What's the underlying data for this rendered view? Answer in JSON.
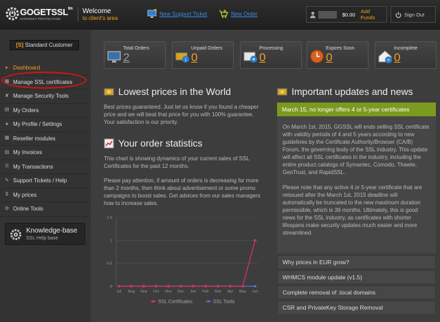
{
  "logo": {
    "name": "GOGETSSL",
    "tm": "tm",
    "sub": "INTERNET PROTECTION"
  },
  "header": {
    "welcome": "Welcome",
    "welcome_sub": "to client's area",
    "new_ticket": "New Support Ticket",
    "new_order": "New Order",
    "balance": "$0.00",
    "add_funds": "Add Funds",
    "sign_out": "Sign Out"
  },
  "sidebar": {
    "plan_prefix": "[S]",
    "plan": "Standard Customer",
    "items": [
      {
        "label": "Dashboard",
        "icon": "arrow-right-icon"
      },
      {
        "label": "Manage SSL certificates",
        "icon": "lock-icon"
      },
      {
        "label": "Manage Security Tools",
        "icon": "tools-icon"
      },
      {
        "label": "My Orders",
        "icon": "document-icon"
      },
      {
        "label": "My Profile / Settings",
        "icon": "user-icon"
      },
      {
        "label": "Reseller modules",
        "icon": "modules-icon"
      },
      {
        "label": "My Invoices",
        "icon": "invoice-icon"
      },
      {
        "label": "My Transactions",
        "icon": "list-icon"
      },
      {
        "label": "Support Tickets / Help",
        "icon": "help-icon"
      },
      {
        "label": "My prices",
        "icon": "dollar-icon"
      },
      {
        "label": "Online Tools",
        "icon": "gear-icon"
      }
    ],
    "kb_title": "Knowledge-base",
    "kb_sub": "SSL Help base"
  },
  "stats": [
    {
      "label": "Total Orders",
      "value": "2"
    },
    {
      "label": "Unpaid Orders",
      "value": "0"
    },
    {
      "label": "Processing",
      "value": "0"
    },
    {
      "label": "Expires Soon",
      "value": "0"
    },
    {
      "label": "Incomplete",
      "value": "0"
    }
  ],
  "main": {
    "prices_title": "Lowest prices in the World",
    "prices_text": "Best prices guaranteed. Just let us know if you found a cheaper price and we will beat that price for you with 100% guarantee. Your satisfaction is our priority.",
    "stats_title": "Your order statistics",
    "stats_text1": "This chart is showing dynamics of your current sales of SSL Certificates for the past 12 months.",
    "stats_text2": "Please pay attention, if amount of orders is decreasing for more than 2 months, then think about advertisement or some promo campaigns to boost sales. Get advices from our sales managers how to increase sales."
  },
  "updates": {
    "title": "Important updates and news",
    "headline": "March 15, no longer offers 4 or 5-year certificates",
    "p1": "On March 1st, 2015, GGSSL will ends selling SSL certificate with validity periods of 4 and 5 years according to new guidelines by the Certificate Authority/Browser (CA/B) Forum, the governing body of the SSL industry. This update will affect all SSL certificates in the industry, including the entire product catalogs of Symantec, Comodo, Thawte, GeoTrust, and RapidSSL.",
    "p2": "Please note that any active 4 or 5-year certificate that are reissued after the March 1st, 2015 deadline will automatically be truncated to the new maximum duration permissible, which is 39 months. Ultimately, this is good news for the SSL industry, as certificates with shorter lifespans make security updates much easier and more streamlined.",
    "items": [
      "Why prices in EUR grow?",
      "WHMCS module update (v1.5)",
      "Complete removal of .local domains",
      "CSR and PrivateKey Storage Removal"
    ]
  },
  "chart_data": {
    "type": "line",
    "categories": [
      "Jul",
      "Aug",
      "Sep",
      "Oct",
      "Nov",
      "Dec",
      "Jan",
      "Feb",
      "Mar",
      "Apr",
      "May",
      "Jun"
    ],
    "yticks": [
      "0",
      "0.5",
      "1",
      "1.5"
    ],
    "ylim": [
      0,
      1.5
    ],
    "series": [
      {
        "name": "SSL Certificates",
        "color": "#e0306a",
        "values": [
          0,
          0,
          0,
          0,
          0,
          0,
          0,
          0,
          0,
          0,
          0,
          1
        ]
      },
      {
        "name": "SSL Tools",
        "color": "#5577cc",
        "values": [
          0,
          0,
          0,
          0,
          0,
          0,
          0,
          0,
          0,
          0,
          0,
          0
        ]
      }
    ]
  }
}
